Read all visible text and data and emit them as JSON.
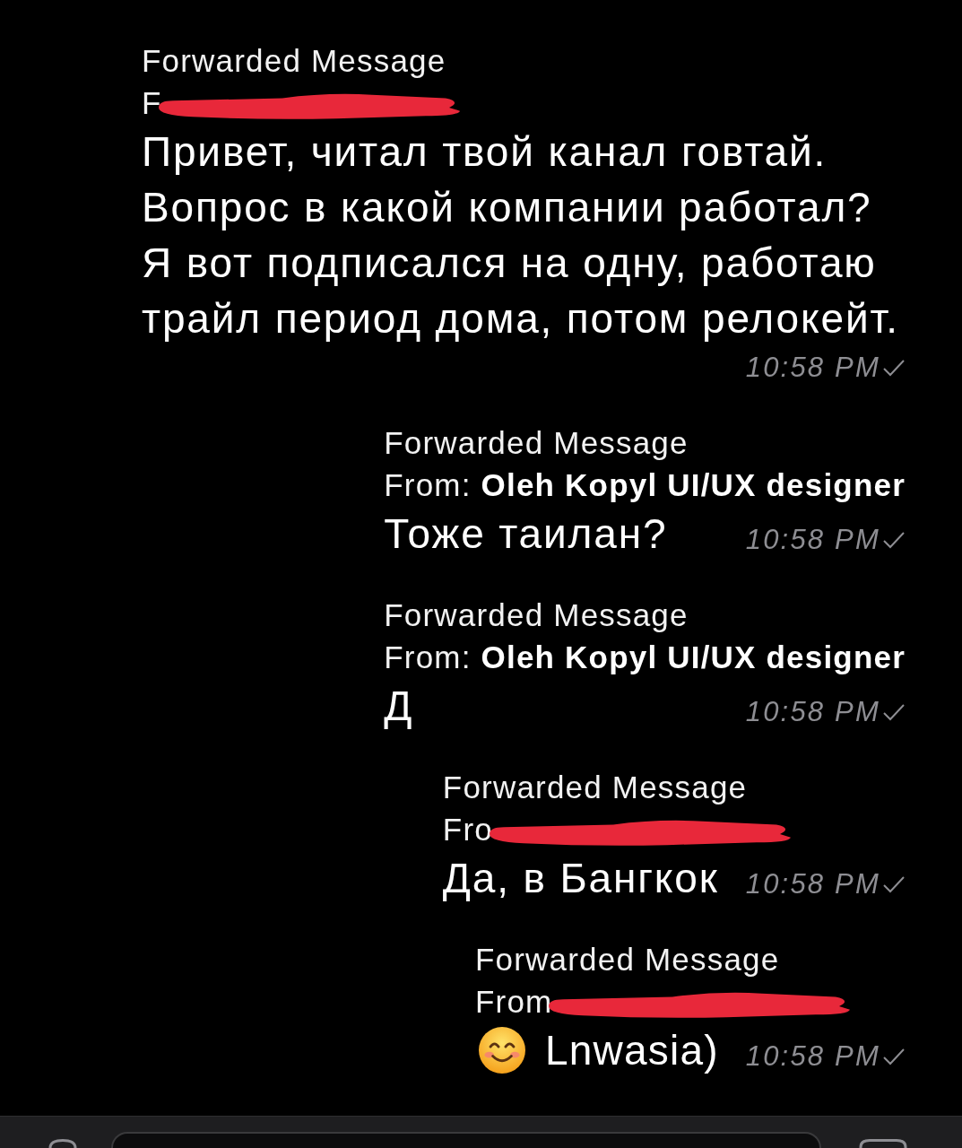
{
  "messages": [
    {
      "header": "Forwarded Message",
      "from": "F",
      "redacted": true,
      "kind": "text",
      "text": "Привет, читал твой канал говтай.\nВопрос в какой компании работал?\nЯ вот подписался на одну, работаю\nтрайл период дома, потом релокейт.",
      "time": "10:58 PM",
      "read": false
    },
    {
      "header": "Forwarded Message",
      "from": "From: **Oleh Kopyl UI/UX designer**",
      "redacted": false,
      "kind": "text",
      "text": "Тоже таилан?",
      "time": "10:58 PM",
      "read": false
    },
    {
      "header": "Forwarded Message",
      "from": "From: **Oleh Kopyl UI/UX designer**",
      "redacted": false,
      "kind": "text",
      "text": "Д",
      "time": "10:58 PM",
      "read": false
    },
    {
      "header": "Forwarded Message",
      "from": "Fro",
      "redacted": true,
      "kind": "text",
      "text": "Да, в Бангкок",
      "time": "10:58 PM",
      "read": false
    },
    {
      "header": "Forwarded Message",
      "from": "From",
      "redacted": true,
      "kind": "emoji",
      "text": "Lnwasia)",
      "time": "10:58 PM",
      "read": false
    }
  ]
}
